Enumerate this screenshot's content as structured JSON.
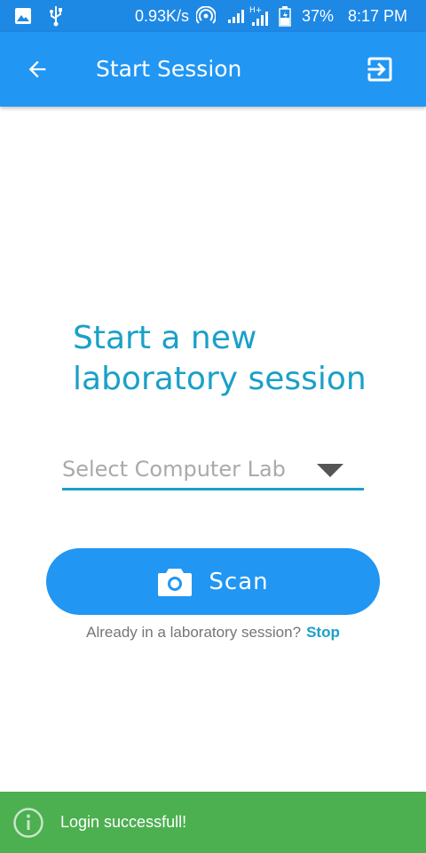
{
  "statusbar": {
    "speed": "0.93K/s",
    "battery": "37%",
    "time": "8:17 PM",
    "icons": [
      "image-icon",
      "usb-icon",
      "hotspot-icon",
      "signal-icon",
      "signal-h-plus-icon",
      "battery-icon"
    ]
  },
  "appbar": {
    "title": "Start Session",
    "back_icon": "arrow-back-icon",
    "action_icon": "exit-to-app-icon"
  },
  "main": {
    "headline": "Start a new laboratory session",
    "dropdown_placeholder": "Select Computer Lab",
    "scan_label": "Scan",
    "already_text": "Already in a laboratory session?",
    "stop_link": "Stop"
  },
  "snackbar": {
    "message": "Login successfull!",
    "icon": "info-icon"
  },
  "colors": {
    "statusbar": "#1e88e5",
    "appbar": "#2196f3",
    "accent": "#1aa0c8",
    "snackbar": "#4caf50"
  }
}
